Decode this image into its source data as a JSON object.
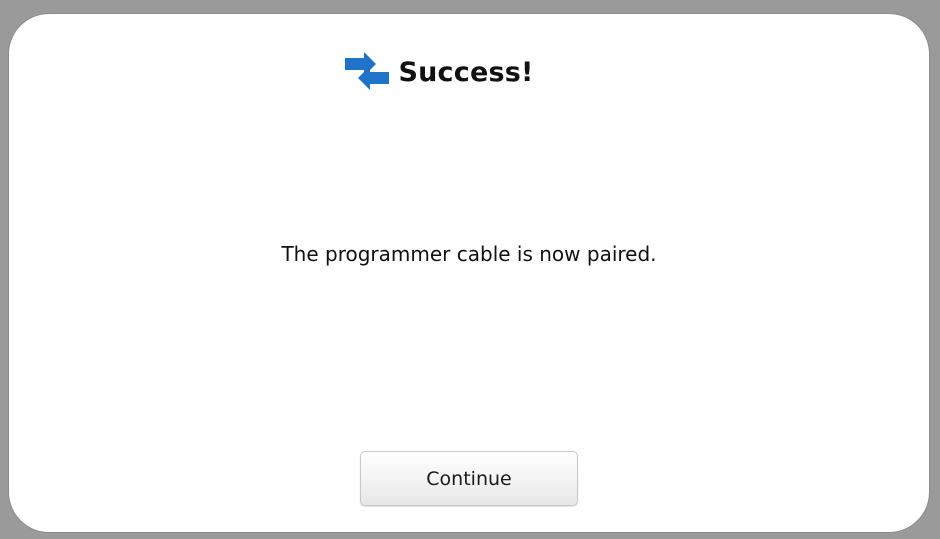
{
  "header": {
    "title": "Success!",
    "icon": "pairing-arrows-icon",
    "icon_color": "#1f73c8"
  },
  "main": {
    "message": "The programmer cable is now paired."
  },
  "footer": {
    "continue_label": "Continue"
  }
}
